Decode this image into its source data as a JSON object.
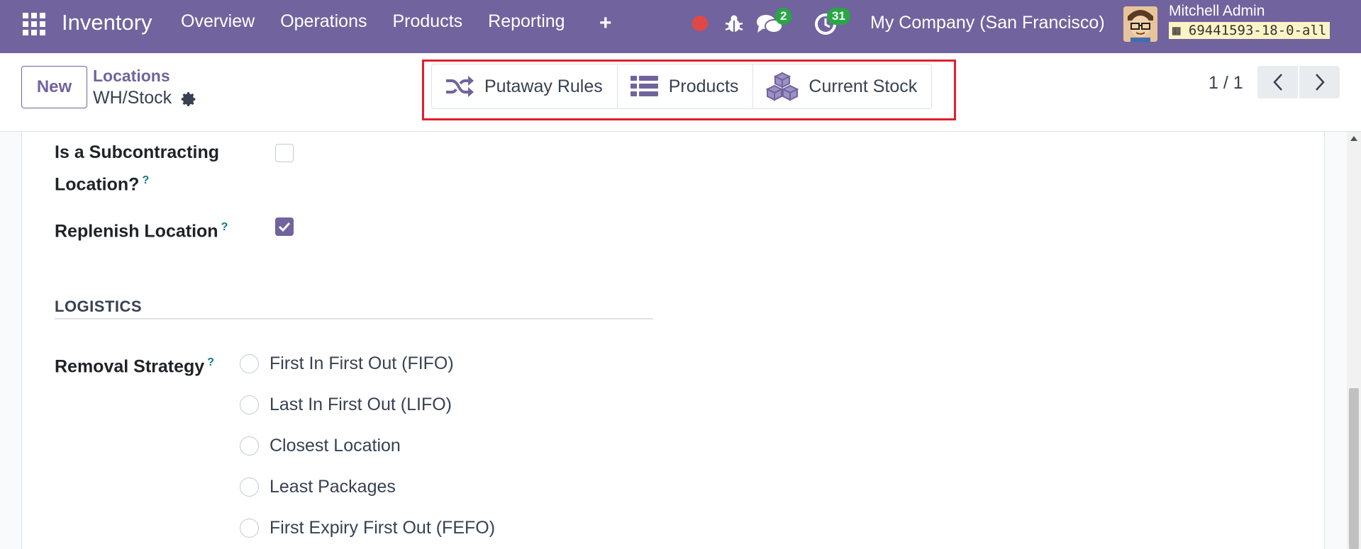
{
  "navbar": {
    "app_name": "Inventory",
    "menu": [
      "Overview",
      "Operations",
      "Products",
      "Reporting"
    ],
    "plus_icon": "+",
    "chat_count": "2",
    "activity_count": "31",
    "company": "My Company (San Francisco)",
    "user_name": "Mitchell Admin",
    "db_name": "69441593-18-0-all"
  },
  "control_panel": {
    "new_label": "New",
    "breadcrumb_parent": "Locations",
    "breadcrumb_current": "WH/Stock",
    "smart_buttons": [
      {
        "label": "Putaway Rules",
        "icon": "shuffle-icon"
      },
      {
        "label": "Products",
        "icon": "list-icon"
      },
      {
        "label": "Current Stock",
        "icon": "cubes-icon"
      }
    ],
    "pager": "1 / 1"
  },
  "form": {
    "subcontracting_label_line1": "Is a Subcontracting",
    "subcontracting_label_line2": "Location?",
    "subcontracting_checked": false,
    "replenish_label": "Replenish Location",
    "replenish_checked": true,
    "help_mark": "?",
    "section_logistics": "LOGISTICS",
    "removal_strategy_label": "Removal Strategy",
    "removal_options": [
      "First In First Out (FIFO)",
      "Last In First Out (LIFO)",
      "Closest Location",
      "Least Packages",
      "First Expiry First Out (FEFO)"
    ]
  },
  "colors": {
    "brand": "#71639e",
    "highlight": "#e0202e",
    "badge": "#28a745"
  }
}
